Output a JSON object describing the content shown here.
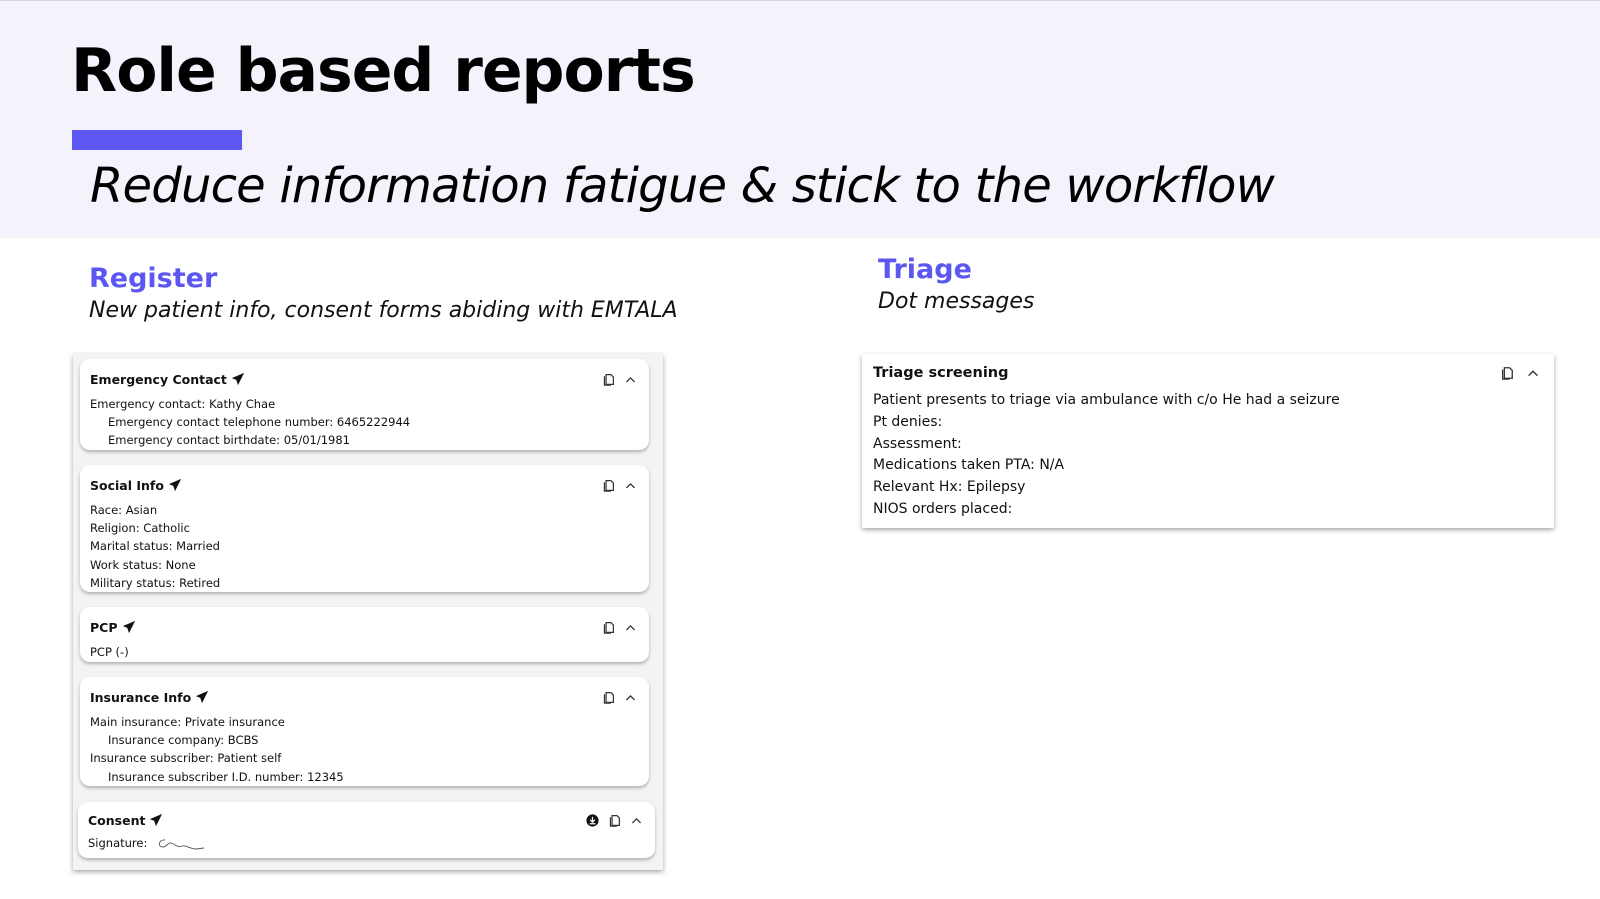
{
  "page": {
    "title": "Role based reports",
    "subtitle": "Reduce information fatigue & stick to the workflow",
    "accent_color": "#5b57f0"
  },
  "register": {
    "title": "Register",
    "subtitle": "New patient info, consent forms abiding with EMTALA",
    "cards": {
      "emergency": {
        "title": "Emergency Contact",
        "lines": [
          "Emergency contact: Kathy Chae",
          "Emergency contact telephone number: 6465222944",
          "Emergency contact birthdate: 05/01/1981"
        ]
      },
      "social": {
        "title": "Social Info",
        "lines": [
          "Race: Asian",
          "Religion: Catholic",
          "Marital status: Married",
          "Work status: None",
          "Military status: Retired"
        ]
      },
      "pcp": {
        "title": "PCP",
        "lines": [
          "PCP (-)"
        ]
      },
      "insurance": {
        "title": "Insurance Info",
        "lines": [
          "Main insurance: Private insurance",
          "Insurance company: BCBS",
          "Insurance subscriber: Patient self",
          "Insurance subscriber I.D. number: 12345"
        ]
      },
      "consent": {
        "title": "Consent",
        "signature_label": "Signature:"
      }
    }
  },
  "triage": {
    "title": "Triage",
    "subtitle": "Dot messages",
    "card": {
      "title": "Triage screening",
      "lines": [
        "Patient presents to triage via ambulance with c/o He had a seizure",
        "Pt denies:",
        "Assessment:",
        "Medications taken PTA: N/A",
        "Relevant Hx: Epilepsy",
        "NIOS orders placed:"
      ]
    }
  },
  "icons": {
    "send": "paper-plane-icon",
    "copy": "copy-icon",
    "collapse": "chevron-up-icon",
    "download": "download-icon"
  }
}
